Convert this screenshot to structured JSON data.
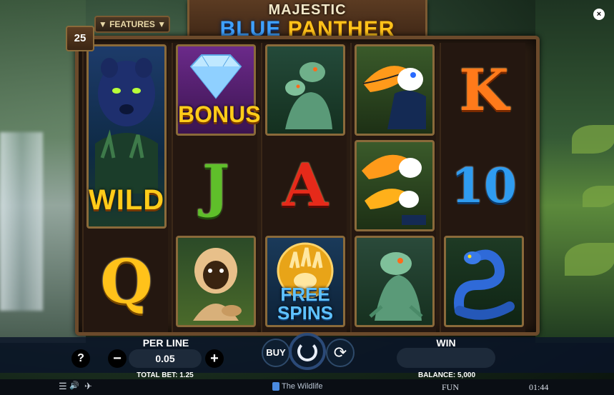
{
  "game": {
    "title_top": "MAJESTIC",
    "title_blue": "BLUE",
    "title_gold": "PANTHER",
    "features_label": "▼ FEATURES ▼",
    "lines": "25"
  },
  "reels": [
    {
      "name": "reel-1",
      "cells": [
        {
          "symbol": "wild-panther-icon",
          "label": "WILD",
          "span": 2
        },
        {
          "symbol": "queen-icon",
          "label": "Q"
        }
      ]
    },
    {
      "name": "reel-2",
      "cells": [
        {
          "symbol": "bonus-diamond-icon",
          "label": "BONUS"
        },
        {
          "symbol": "jack-icon",
          "label": "J"
        },
        {
          "symbol": "monkey-icon",
          "label": ""
        }
      ]
    },
    {
      "name": "reel-3",
      "cells": [
        {
          "symbol": "lizards-icon",
          "label": ""
        },
        {
          "symbol": "ace-icon",
          "label": "A"
        },
        {
          "symbol": "free-spins-icon",
          "label": "FREE SPINS"
        }
      ]
    },
    {
      "name": "reel-4",
      "cells": [
        {
          "symbol": "toucan-icon",
          "label": ""
        },
        {
          "symbol": "toucans-icon",
          "label": ""
        },
        {
          "symbol": "lizard-icon",
          "label": ""
        }
      ]
    },
    {
      "name": "reel-5",
      "cells": [
        {
          "symbol": "king-icon",
          "label": "K"
        },
        {
          "symbol": "ten-icon",
          "label": "10"
        },
        {
          "symbol": "snake-icon",
          "label": ""
        }
      ]
    }
  ],
  "controls": {
    "help": "?",
    "per_line_label": "PER LINE",
    "minus": "−",
    "plus": "+",
    "bet_value": "0.05",
    "total_bet": "TOTAL BET: 1.25",
    "buy": "BUY",
    "win_label": "WIN",
    "balance": "BALANCE: 5,000"
  },
  "footer": {
    "menu_icon": "☰",
    "sound_icon": "🔊",
    "title": "The Wildlife",
    "mode": "FUN",
    "clock": "01:44"
  },
  "close_icon": "×",
  "colors": {
    "gold": "#ffc21a",
    "blue": "#3fa1ff",
    "frame": "#6b4a2b"
  }
}
